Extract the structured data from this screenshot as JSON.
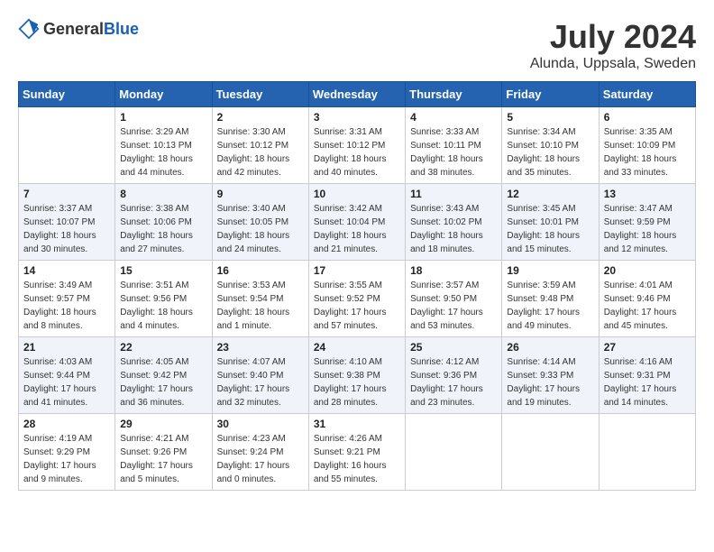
{
  "header": {
    "logo_general": "General",
    "logo_blue": "Blue",
    "month": "July 2024",
    "location": "Alunda, Uppsala, Sweden"
  },
  "days_of_week": [
    "Sunday",
    "Monday",
    "Tuesday",
    "Wednesday",
    "Thursday",
    "Friday",
    "Saturday"
  ],
  "weeks": [
    [
      {
        "day": "",
        "info": ""
      },
      {
        "day": "1",
        "info": "Sunrise: 3:29 AM\nSunset: 10:13 PM\nDaylight: 18 hours\nand 44 minutes."
      },
      {
        "day": "2",
        "info": "Sunrise: 3:30 AM\nSunset: 10:12 PM\nDaylight: 18 hours\nand 42 minutes."
      },
      {
        "day": "3",
        "info": "Sunrise: 3:31 AM\nSunset: 10:12 PM\nDaylight: 18 hours\nand 40 minutes."
      },
      {
        "day": "4",
        "info": "Sunrise: 3:33 AM\nSunset: 10:11 PM\nDaylight: 18 hours\nand 38 minutes."
      },
      {
        "day": "5",
        "info": "Sunrise: 3:34 AM\nSunset: 10:10 PM\nDaylight: 18 hours\nand 35 minutes."
      },
      {
        "day": "6",
        "info": "Sunrise: 3:35 AM\nSunset: 10:09 PM\nDaylight: 18 hours\nand 33 minutes."
      }
    ],
    [
      {
        "day": "7",
        "info": "Sunrise: 3:37 AM\nSunset: 10:07 PM\nDaylight: 18 hours\nand 30 minutes."
      },
      {
        "day": "8",
        "info": "Sunrise: 3:38 AM\nSunset: 10:06 PM\nDaylight: 18 hours\nand 27 minutes."
      },
      {
        "day": "9",
        "info": "Sunrise: 3:40 AM\nSunset: 10:05 PM\nDaylight: 18 hours\nand 24 minutes."
      },
      {
        "day": "10",
        "info": "Sunrise: 3:42 AM\nSunset: 10:04 PM\nDaylight: 18 hours\nand 21 minutes."
      },
      {
        "day": "11",
        "info": "Sunrise: 3:43 AM\nSunset: 10:02 PM\nDaylight: 18 hours\nand 18 minutes."
      },
      {
        "day": "12",
        "info": "Sunrise: 3:45 AM\nSunset: 10:01 PM\nDaylight: 18 hours\nand 15 minutes."
      },
      {
        "day": "13",
        "info": "Sunrise: 3:47 AM\nSunset: 9:59 PM\nDaylight: 18 hours\nand 12 minutes."
      }
    ],
    [
      {
        "day": "14",
        "info": "Sunrise: 3:49 AM\nSunset: 9:57 PM\nDaylight: 18 hours\nand 8 minutes."
      },
      {
        "day": "15",
        "info": "Sunrise: 3:51 AM\nSunset: 9:56 PM\nDaylight: 18 hours\nand 4 minutes."
      },
      {
        "day": "16",
        "info": "Sunrise: 3:53 AM\nSunset: 9:54 PM\nDaylight: 18 hours\nand 1 minute."
      },
      {
        "day": "17",
        "info": "Sunrise: 3:55 AM\nSunset: 9:52 PM\nDaylight: 17 hours\nand 57 minutes."
      },
      {
        "day": "18",
        "info": "Sunrise: 3:57 AM\nSunset: 9:50 PM\nDaylight: 17 hours\nand 53 minutes."
      },
      {
        "day": "19",
        "info": "Sunrise: 3:59 AM\nSunset: 9:48 PM\nDaylight: 17 hours\nand 49 minutes."
      },
      {
        "day": "20",
        "info": "Sunrise: 4:01 AM\nSunset: 9:46 PM\nDaylight: 17 hours\nand 45 minutes."
      }
    ],
    [
      {
        "day": "21",
        "info": "Sunrise: 4:03 AM\nSunset: 9:44 PM\nDaylight: 17 hours\nand 41 minutes."
      },
      {
        "day": "22",
        "info": "Sunrise: 4:05 AM\nSunset: 9:42 PM\nDaylight: 17 hours\nand 36 minutes."
      },
      {
        "day": "23",
        "info": "Sunrise: 4:07 AM\nSunset: 9:40 PM\nDaylight: 17 hours\nand 32 minutes."
      },
      {
        "day": "24",
        "info": "Sunrise: 4:10 AM\nSunset: 9:38 PM\nDaylight: 17 hours\nand 28 minutes."
      },
      {
        "day": "25",
        "info": "Sunrise: 4:12 AM\nSunset: 9:36 PM\nDaylight: 17 hours\nand 23 minutes."
      },
      {
        "day": "26",
        "info": "Sunrise: 4:14 AM\nSunset: 9:33 PM\nDaylight: 17 hours\nand 19 minutes."
      },
      {
        "day": "27",
        "info": "Sunrise: 4:16 AM\nSunset: 9:31 PM\nDaylight: 17 hours\nand 14 minutes."
      }
    ],
    [
      {
        "day": "28",
        "info": "Sunrise: 4:19 AM\nSunset: 9:29 PM\nDaylight: 17 hours\nand 9 minutes."
      },
      {
        "day": "29",
        "info": "Sunrise: 4:21 AM\nSunset: 9:26 PM\nDaylight: 17 hours\nand 5 minutes."
      },
      {
        "day": "30",
        "info": "Sunrise: 4:23 AM\nSunset: 9:24 PM\nDaylight: 17 hours\nand 0 minutes."
      },
      {
        "day": "31",
        "info": "Sunrise: 4:26 AM\nSunset: 9:21 PM\nDaylight: 16 hours\nand 55 minutes."
      },
      {
        "day": "",
        "info": ""
      },
      {
        "day": "",
        "info": ""
      },
      {
        "day": "",
        "info": ""
      }
    ]
  ]
}
